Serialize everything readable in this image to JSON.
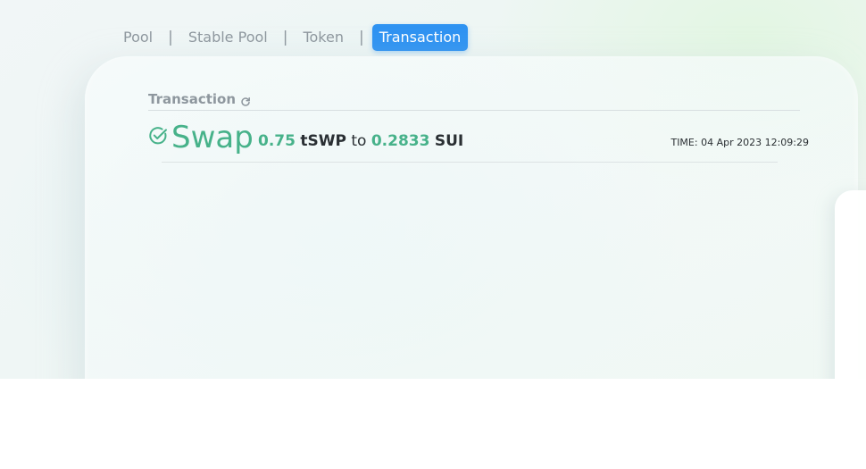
{
  "nav": {
    "tabs": [
      {
        "label": "Pool"
      },
      {
        "label": "Stable Pool"
      },
      {
        "label": "Token"
      },
      {
        "label": "Transaction"
      }
    ],
    "separator": "|",
    "active_index": 3
  },
  "card": {
    "title": "Transaction",
    "refresh_icon": "refresh-icon"
  },
  "transaction": {
    "status_icon": "check-circle-icon",
    "type": "Swap",
    "from_amount": "0.75",
    "from_symbol": "tSWP",
    "connector": "to",
    "to_amount": "0.2833",
    "to_symbol": "SUI",
    "time": "TIME: 04 Apr 2023 12:09:29"
  },
  "colors": {
    "accent": "#2f93f2",
    "success": "#47b28a",
    "muted": "#8e979e",
    "text": "#2a2f33"
  }
}
